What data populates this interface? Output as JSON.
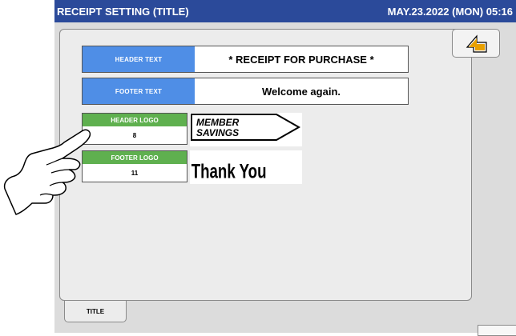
{
  "titlebar": {
    "title": "RECEIPT SETTING (TITLE)",
    "datetime": "MAY.23.2022 (MON) 05:16"
  },
  "rows": [
    {
      "label": "HEADER TEXT",
      "value": "* RECEIPT FOR PURCHASE *"
    },
    {
      "label": "FOOTER TEXT",
      "value": "Welcome again."
    }
  ],
  "logos": [
    {
      "label": "HEADER LOGO",
      "number": "8",
      "image_text_line1": "MEMBER",
      "image_text_line2": "SAVINGS"
    },
    {
      "label": "FOOTER LOGO",
      "number": "11",
      "image_text": "Thank You"
    }
  ],
  "tab": {
    "label": "TITLE"
  },
  "icons": {
    "back": "return-arrow-icon",
    "pointer": "pointing-hand-icon"
  },
  "colors": {
    "titlebar": "#2b4a9a",
    "label_blue": "#4f8ee6",
    "label_green": "#5fb04f",
    "back_arrow": "#e8a000"
  }
}
